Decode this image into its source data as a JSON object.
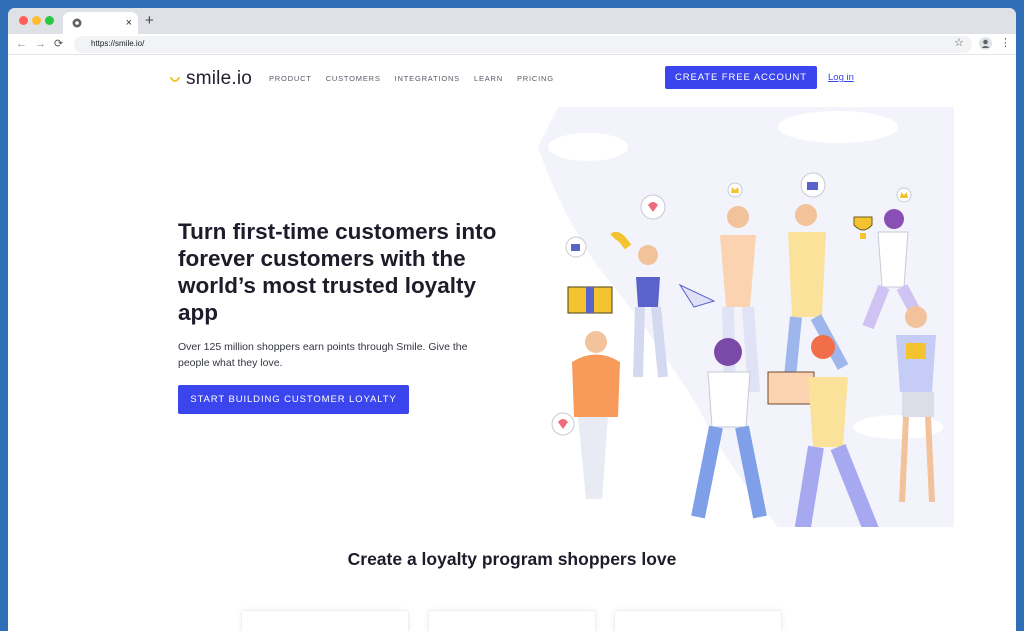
{
  "browser": {
    "tab_close": "×",
    "new_tab": "+",
    "url": "https://smile.io/",
    "back_glyph": "←",
    "forward_glyph": "→",
    "reload_glyph": "⟳",
    "star_glyph": "☆",
    "menu_glyph": "⋮"
  },
  "header": {
    "logo_text": "smile.io",
    "nav": [
      "PRODUCT",
      "CUSTOMERS",
      "INTEGRATIONS",
      "LEARN",
      "PRICING"
    ],
    "cta": "CREATE FREE ACCOUNT",
    "login": "Log in"
  },
  "hero": {
    "title": "Turn first-time customers into forever customers with the world’s most trusted loyalty app",
    "subtitle": "Over 125 million shoppers earn points through Smile. Give the people what they love.",
    "cta": "START BUILDING CUSTOMER LOYALTY"
  },
  "section": {
    "title": "Create a loyalty program shoppers love"
  },
  "colors": {
    "brand": "#3b45ed",
    "accent_yellow": "#f4c430",
    "background": "#ffffff"
  }
}
